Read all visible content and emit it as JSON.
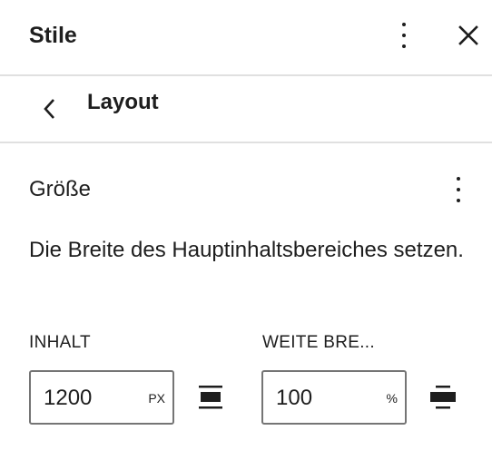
{
  "header": {
    "title": "Stile",
    "options_icon": "vertical-ellipsis-icon",
    "close_icon": "close-icon"
  },
  "subnav": {
    "back_icon": "chevron-left-icon",
    "label": "Layout"
  },
  "panel": {
    "title": "Größe",
    "options_icon": "vertical-ellipsis-icon",
    "description": "Die Breite des Hauptinhaltsbereiches setzen."
  },
  "fields": [
    {
      "label": "INHALT",
      "value": "1200",
      "unit": "PX",
      "icon": "align-none-icon"
    },
    {
      "label": "WEITE BRE...",
      "value": "100",
      "unit": "%",
      "icon": "align-wide-icon"
    }
  ]
}
